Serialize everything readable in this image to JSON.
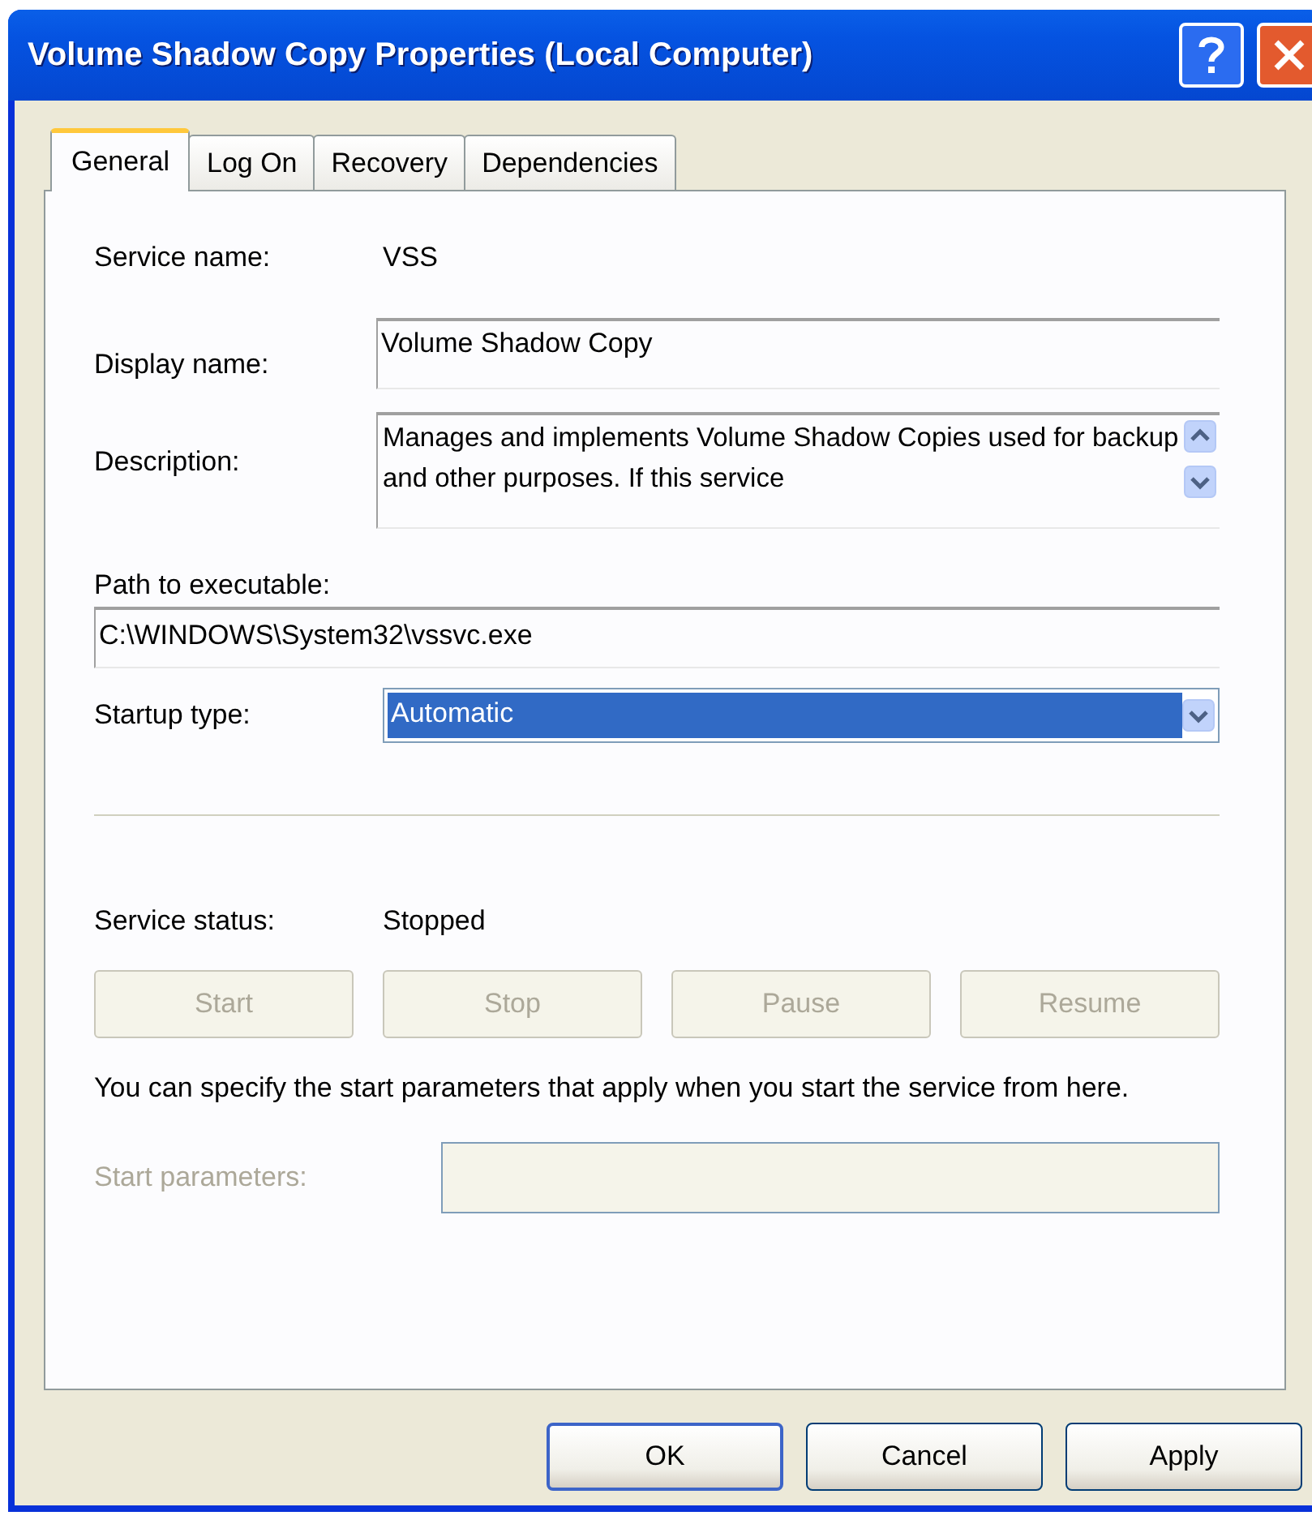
{
  "window": {
    "title": "Volume Shadow Copy Properties (Local Computer)"
  },
  "tabs": [
    {
      "label": "General",
      "selected": true
    },
    {
      "label": "Log On",
      "selected": false
    },
    {
      "label": "Recovery",
      "selected": false
    },
    {
      "label": "Dependencies",
      "selected": false
    }
  ],
  "service_name": {
    "label": "Service name:",
    "value": "VSS"
  },
  "display_name": {
    "label": "Display name:",
    "value": "Volume Shadow Copy"
  },
  "description": {
    "label": "Description:",
    "value": "Manages and implements Volume Shadow Copies used for backup and other purposes. If this service"
  },
  "path": {
    "label": "Path to executable:",
    "value": "C:\\WINDOWS\\System32\\vssvc.exe"
  },
  "startup_type": {
    "label": "Startup type:",
    "value": "Automatic",
    "highlighted": true
  },
  "service_status": {
    "label": "Service status:",
    "value": "Stopped"
  },
  "service_buttons": [
    {
      "label": "Start",
      "disabled": true
    },
    {
      "label": "Stop",
      "disabled": true
    },
    {
      "label": "Pause",
      "disabled": true
    },
    {
      "label": "Resume",
      "disabled": true
    }
  ],
  "hint": "You can specify the start parameters that apply when you start the service from here.",
  "start_parameters": {
    "label": "Start parameters:",
    "disabled": true
  },
  "dialog_buttons": [
    {
      "label": "OK",
      "default": true
    },
    {
      "label": "Cancel",
      "default": false
    },
    {
      "label": "Apply",
      "default": false
    }
  ]
}
